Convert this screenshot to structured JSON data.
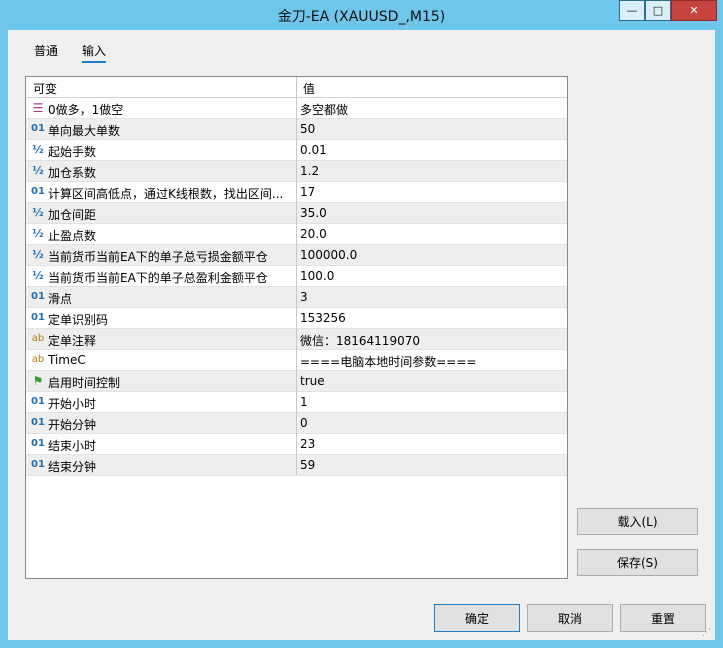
{
  "window": {
    "title": "金刀-EA (XAUUSD_,M15)",
    "controls": {
      "minimize": "—",
      "maximize": "□",
      "close": "✕"
    }
  },
  "tabs": [
    {
      "label": "普通",
      "active": false
    },
    {
      "label": "输入",
      "active": true
    }
  ],
  "grid": {
    "headers": {
      "name": "可变",
      "value": "值"
    },
    "rows": [
      {
        "icon": "enum-icon",
        "glyph": "☰",
        "name": "0做多，1做空",
        "value": "多空都做"
      },
      {
        "icon": "integer-icon",
        "glyph": "01",
        "name": "单向最大单数",
        "value": "50"
      },
      {
        "icon": "double-icon",
        "glyph": "½",
        "name": "起始手数",
        "value": "0.01"
      },
      {
        "icon": "double-icon",
        "glyph": "½",
        "name": "加仓系数",
        "value": "1.2"
      },
      {
        "icon": "integer-icon",
        "glyph": "01",
        "name": "计算区间高低点，通过K线根数，找出区间...",
        "value": "17"
      },
      {
        "icon": "double-icon",
        "glyph": "½",
        "name": "加仓间距",
        "value": "35.0"
      },
      {
        "icon": "double-icon",
        "glyph": "½",
        "name": "止盈点数",
        "value": "20.0"
      },
      {
        "icon": "double-icon",
        "glyph": "½",
        "name": "当前货币当前EA下的单子总亏损金额平仓",
        "value": "100000.0"
      },
      {
        "icon": "double-icon",
        "glyph": "½",
        "name": "当前货币当前EA下的单子总盈利金额平仓",
        "value": "100.0"
      },
      {
        "icon": "integer-icon",
        "glyph": "01",
        "name": "滑点",
        "value": "3"
      },
      {
        "icon": "integer-icon",
        "glyph": "01",
        "name": "定单识别码",
        "value": "153256"
      },
      {
        "icon": "string-icon",
        "glyph": "ab",
        "name": "定单注释",
        "value": "微信：18164119070"
      },
      {
        "icon": "string-icon",
        "glyph": "ab",
        "name": "TimeC",
        "value": "====电脑本地时间参数===="
      },
      {
        "icon": "bool-icon",
        "glyph": "⚑",
        "name": "启用时间控制",
        "value": "true"
      },
      {
        "icon": "integer-icon",
        "glyph": "01",
        "name": "开始小时",
        "value": "1"
      },
      {
        "icon": "integer-icon",
        "glyph": "01",
        "name": "开始分钟",
        "value": "0"
      },
      {
        "icon": "integer-icon",
        "glyph": "01",
        "name": "结束小时",
        "value": "23"
      },
      {
        "icon": "integer-icon",
        "glyph": "01",
        "name": "结束分钟",
        "value": "59"
      }
    ]
  },
  "buttons": {
    "load": "载入(L)",
    "save": "保存(S)",
    "ok": "确定",
    "cancel": "取消",
    "reset": "重置"
  }
}
